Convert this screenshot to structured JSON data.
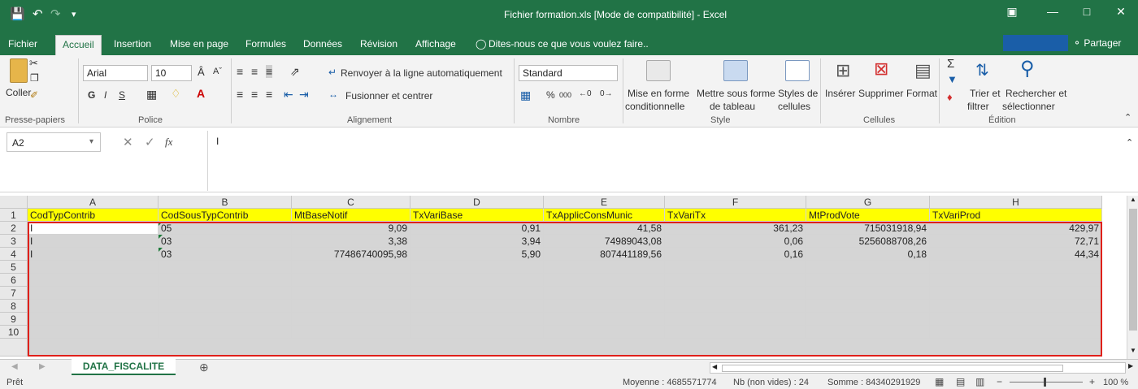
{
  "app": {
    "title": "Fichier formation.xls  [Mode de compatibilité] - Excel",
    "share_label": "Partager",
    "tell_me": "Dites-nous ce que vous voulez faire..",
    "menus": [
      "Fichier",
      "Accueil",
      "Insertion",
      "Mise en page",
      "Formules",
      "Données",
      "Révision",
      "Affichage"
    ],
    "active_menu": "Accueil"
  },
  "ribbon": {
    "clipboard": {
      "paste": "Coller",
      "group": "Presse-papiers"
    },
    "font": {
      "name": "Arial",
      "size": "10",
      "bold": "G",
      "italic": "I",
      "underline": "S",
      "group": "Police"
    },
    "alignment": {
      "wrap": "Renvoyer à la ligne automatiquement",
      "merge": "Fusionner et centrer",
      "group": "Alignement"
    },
    "number": {
      "format": "Standard",
      "percent": "%",
      "thousands": "000",
      "group": "Nombre"
    },
    "style": {
      "conditional": "Mise en forme",
      "conditional2": "conditionnelle",
      "table": "Mettre sous forme",
      "table2": "de tableau",
      "cell_styles": "Styles de",
      "cell_styles2": "cellules",
      "group": "Style"
    },
    "cells": {
      "insert": "Insérer",
      "delete": "Supprimer",
      "format": "Format",
      "group": "Cellules"
    },
    "editing": {
      "sort": "Trier et",
      "sort2": "filtrer",
      "find": "Rechercher et",
      "find2": "sélectionner",
      "group": "Édition"
    }
  },
  "formula_bar": {
    "name_box": "A2",
    "fx": "fx",
    "value": "I"
  },
  "sheet": {
    "columns": [
      "A",
      "B",
      "C",
      "D",
      "E",
      "F",
      "G",
      "H"
    ],
    "rows": [
      "1",
      "2",
      "3",
      "4",
      "5",
      "6",
      "7",
      "8",
      "9",
      "10"
    ],
    "headers": [
      "CodTypContrib",
      "CodSousTypContrib",
      "MtBaseNotif",
      "TxVariBase",
      "TxApplicConsMunic",
      "TxVariTx",
      "MtProdVote",
      "TxVariProd"
    ],
    "data": [
      [
        "I",
        "05",
        "9,09",
        "0,91",
        "41,58",
        "361,23",
        "715031918,94",
        "429,97"
      ],
      [
        "I",
        "03",
        "3,38",
        "3,94",
        "74989043,08",
        "0,06",
        "5256088708,26",
        "72,71"
      ],
      [
        "I",
        "03",
        "77486740095,98",
        "5,90",
        "807441189,56",
        "0,16",
        "0,18",
        "44,34"
      ]
    ]
  },
  "tabs": {
    "active": "DATA_FISCALITE"
  },
  "status": {
    "ready": "Prêt",
    "average": "Moyenne : 4685571774",
    "count": "Nb (non vides) : 24",
    "sum": "Somme : 84340291929",
    "zoom": "100 %"
  },
  "colors": {
    "excel_green": "#217346",
    "selection": "#e0201a",
    "header_fill": "#ffff00",
    "selected_fill": "#d5d5d5"
  }
}
